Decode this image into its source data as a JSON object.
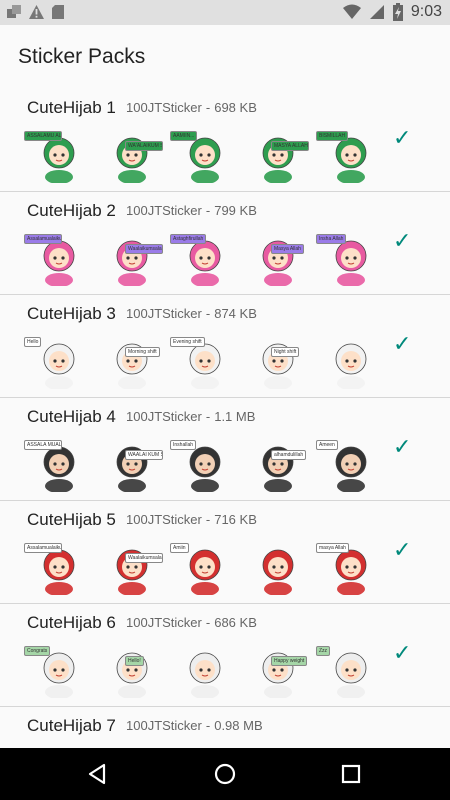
{
  "status_bar": {
    "time": "9:03",
    "icons": [
      "notification-icon",
      "alert-icon",
      "sd-card-icon",
      "wifi-icon",
      "signal-icon",
      "battery-charging-icon"
    ]
  },
  "header": {
    "title": "Sticker Packs"
  },
  "packs": [
    {
      "name": "CuteHijab 1",
      "publisher": "100JTSticker",
      "size": "698 KB",
      "installed": true,
      "stickers": [
        "ASSALAMU ALAIKUM",
        "WA'ALAIKUM SALAM",
        "AAMIIN...",
        "MASYA ALLAH",
        "BISMILLAH"
      ]
    },
    {
      "name": "CuteHijab 2",
      "publisher": "100JTSticker",
      "size": "799 KB",
      "installed": true,
      "stickers": [
        "Assalamualaikum",
        "Waalaikumsalam",
        "Astaghfirullah",
        "Masya Allah",
        "Insha Allah"
      ]
    },
    {
      "name": "CuteHijab 3",
      "publisher": "100JTSticker",
      "size": "874 KB",
      "installed": true,
      "stickers": [
        "Hello",
        "Morning shift",
        "Evening shift",
        "Night shift",
        ""
      ]
    },
    {
      "name": "CuteHijab 4",
      "publisher": "100JTSticker",
      "size": "1.1 MB",
      "installed": true,
      "stickers": [
        "ASSALA MUALAI KUM",
        "WAALAI KUM SALAM",
        "Inshallah",
        "alhamdulillah",
        "Ameen"
      ]
    },
    {
      "name": "CuteHijab 5",
      "publisher": "100JTSticker",
      "size": "716 KB",
      "installed": true,
      "stickers": [
        "Assalamualaikum",
        "Waalaikumsalam",
        "Amiin",
        "",
        "masya Allah"
      ]
    },
    {
      "name": "CuteHijab 6",
      "publisher": "100JTSticker",
      "size": "686 KB",
      "installed": true,
      "stickers": [
        "Congrats",
        "Hello!",
        "",
        "Happy weight",
        "Zzz"
      ]
    },
    {
      "name": "CuteHijab 7",
      "publisher": "100JTSticker",
      "size": "0.98 MB",
      "installed": false,
      "stickers": []
    }
  ],
  "separator": "-",
  "check_icon": "✓",
  "nav": {
    "back": "back-icon",
    "home": "home-icon",
    "recents": "recents-icon"
  }
}
